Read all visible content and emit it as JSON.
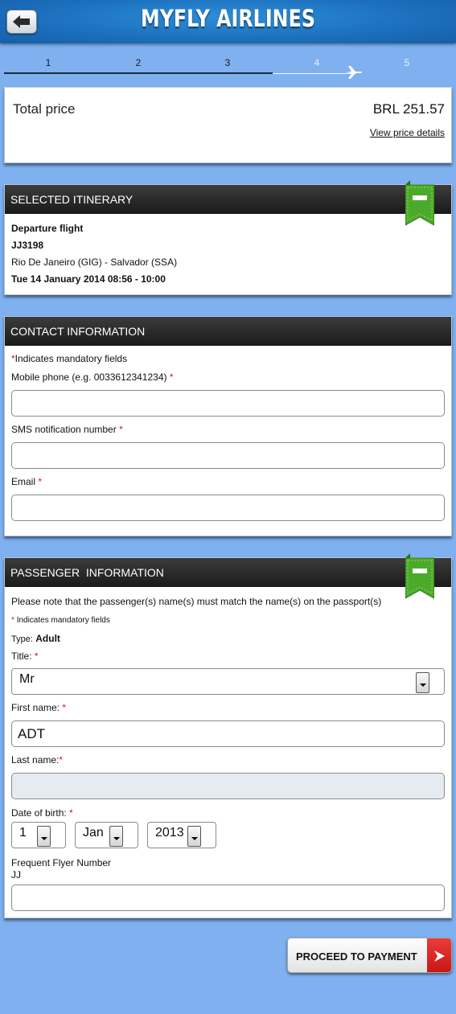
{
  "header": {
    "title": "MYFLY AIRLINES"
  },
  "steps": [
    "1",
    "2",
    "3",
    "4",
    "5"
  ],
  "price": {
    "label": "Total price",
    "value": "BRL 251.57",
    "details_link": "View price details"
  },
  "itinerary": {
    "heading": "SELECTED ITINERARY",
    "direction": "Departure flight",
    "flight_number": "JJ3198",
    "route": "Rio De Janeiro (GIG) - Salvador (SSA)",
    "datetime": "Tue 14 January 2014 08:56 - 10:00"
  },
  "contact": {
    "heading": "CONTACT INFORMATION",
    "mandatory_note": "Indicates mandatory fields",
    "mobile_label": "Mobile phone (e.g. 0033612341234)",
    "sms_label": "SMS notification number",
    "email_label": "Email",
    "required_mark": "*"
  },
  "passenger": {
    "heading": "PASSENGER  INFORMATION",
    "passport_note": "Please note that the passenger(s) name(s) must match the name(s) on the passport(s)",
    "mandatory_note": "Indicates mandatory fields",
    "type_label": "Type:",
    "type_value": "Adult",
    "title_label": "Title:",
    "title_value": "Mr",
    "first_name_label": "First name:",
    "first_name_value": "ADT",
    "last_name_label": "Last name:",
    "last_name_value": "",
    "dob_label": "Date of birth:",
    "dob_day": "1",
    "dob_month": "Jan",
    "dob_year": "2013",
    "ffn_label": "Frequent Flyer Number",
    "ffn_prefix": "JJ"
  },
  "actions": {
    "proceed_label": "PROCEED TO PAYMENT"
  },
  "colors": {
    "header_blue": "#1c6fbd",
    "background": "#7fb0ef",
    "panel_head": "#2a2a2a",
    "ribbon_green": "#4caa2a",
    "required_red": "#d01818",
    "proceed_red": "#d62222"
  }
}
